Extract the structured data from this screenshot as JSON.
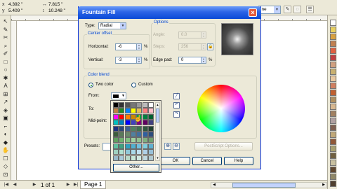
{
  "app": {
    "coords": {
      "x": "4.392 \"",
      "y": "5.409 \"",
      "w": "7.815 \"",
      "h": "10.248 \""
    },
    "right_combo": "ine",
    "tools": [
      "↖",
      "✎",
      "✂",
      "⌕",
      "✐",
      "□",
      "○",
      "✱",
      "A",
      "⊞",
      "↗",
      "◈",
      "▣",
      "⌐",
      "◐",
      "◆",
      "✋",
      "☐",
      "◇",
      "⊡"
    ],
    "palette_colors": [
      "#ffffff",
      "#e8d060",
      "#d8a040",
      "#c08050",
      "#e06040",
      "#c04040",
      "#d0a080",
      "#c8b070",
      "#e8c8a0",
      "#d08060",
      "#c06030",
      "#b09060",
      "#d8b890",
      "#a08060",
      "#b0a0a0",
      "#806050",
      "#c0a878",
      "#905838",
      "#a8a070",
      "#706040",
      "#c8c0a0",
      "#604830",
      "#908868",
      "#504030"
    ]
  },
  "statusbar": {
    "page_count": "1 of 1",
    "page_tab": "Page 1"
  },
  "dialog": {
    "title": "Fountain Fill",
    "type_label": "Type:",
    "type_value": "Radial",
    "options_label": "Options",
    "angle_label": "Angle:",
    "angle_value": "0.0",
    "steps_label": "Steps:",
    "steps_value": "256",
    "edge_pad_label": "Edge pad:",
    "edge_pad_value": "0",
    "pct": "%",
    "center_offset_label": "Center offset",
    "horizontal_label": "Horizontal:",
    "horizontal_value": "-6",
    "vertical_label": "Vertical:",
    "vertical_value": "-3",
    "color_blend_label": "Color blend",
    "two_color_label": "Two color",
    "custom_label": "Custom",
    "from_label": "From:",
    "to_label": "To:",
    "midpoint_label": "Mid-point:",
    "presets_label": "Presets:",
    "postscript_label": "PostScript Options...",
    "ok_label": "OK",
    "cancel_label": "Cancel",
    "help_label": "Help"
  },
  "popup": {
    "other_label": "Other...",
    "colors": [
      "#000000",
      "#333333",
      "#555555",
      "#777777",
      "#999999",
      "#bbbbbb",
      "#ffffff",
      "#c08040",
      "#228b22",
      "#0080ff",
      "#ffff00",
      "#e0c060",
      "#ff8080",
      "#ffc0cb",
      "#ff00ff",
      "#ff0000",
      "#ff8000",
      "#cc8800",
      "#00a040",
      "#008040",
      "#006030",
      "#00c0c0",
      "#0080c0",
      "#0000ff",
      "#4040c0",
      "#800080",
      "#600060",
      "#404080",
      "#203080",
      "#304878",
      "#406090",
      "#508060",
      "#407050",
      "#305840",
      "#204030",
      "#3c5c3c",
      "#5a7a5a",
      "#6a8a6a",
      "#5080a0",
      "#4070a0",
      "#3060a0",
      "#2c4c7c",
      "#60a060",
      "#70b070",
      "#80c080",
      "#a0d0a0",
      "#90c090",
      "#80b080",
      "#70a070",
      "#60c0a0",
      "#40a080",
      "#30a0c0",
      "#50b0d0",
      "#70c0e0",
      "#80d0e0",
      "#60b0d0",
      "#a0d0c0",
      "#b0e0d0",
      "#90c8d8",
      "#a8d8e8",
      "#c0e0f0",
      "#b0d0e8",
      "#98c0d8",
      "#98b8c8",
      "#a8c8d8",
      "#b8d8c8",
      "#c8e8d8",
      "#d0e8e0",
      "#c0d8e0",
      "#b0c8d0"
    ]
  }
}
